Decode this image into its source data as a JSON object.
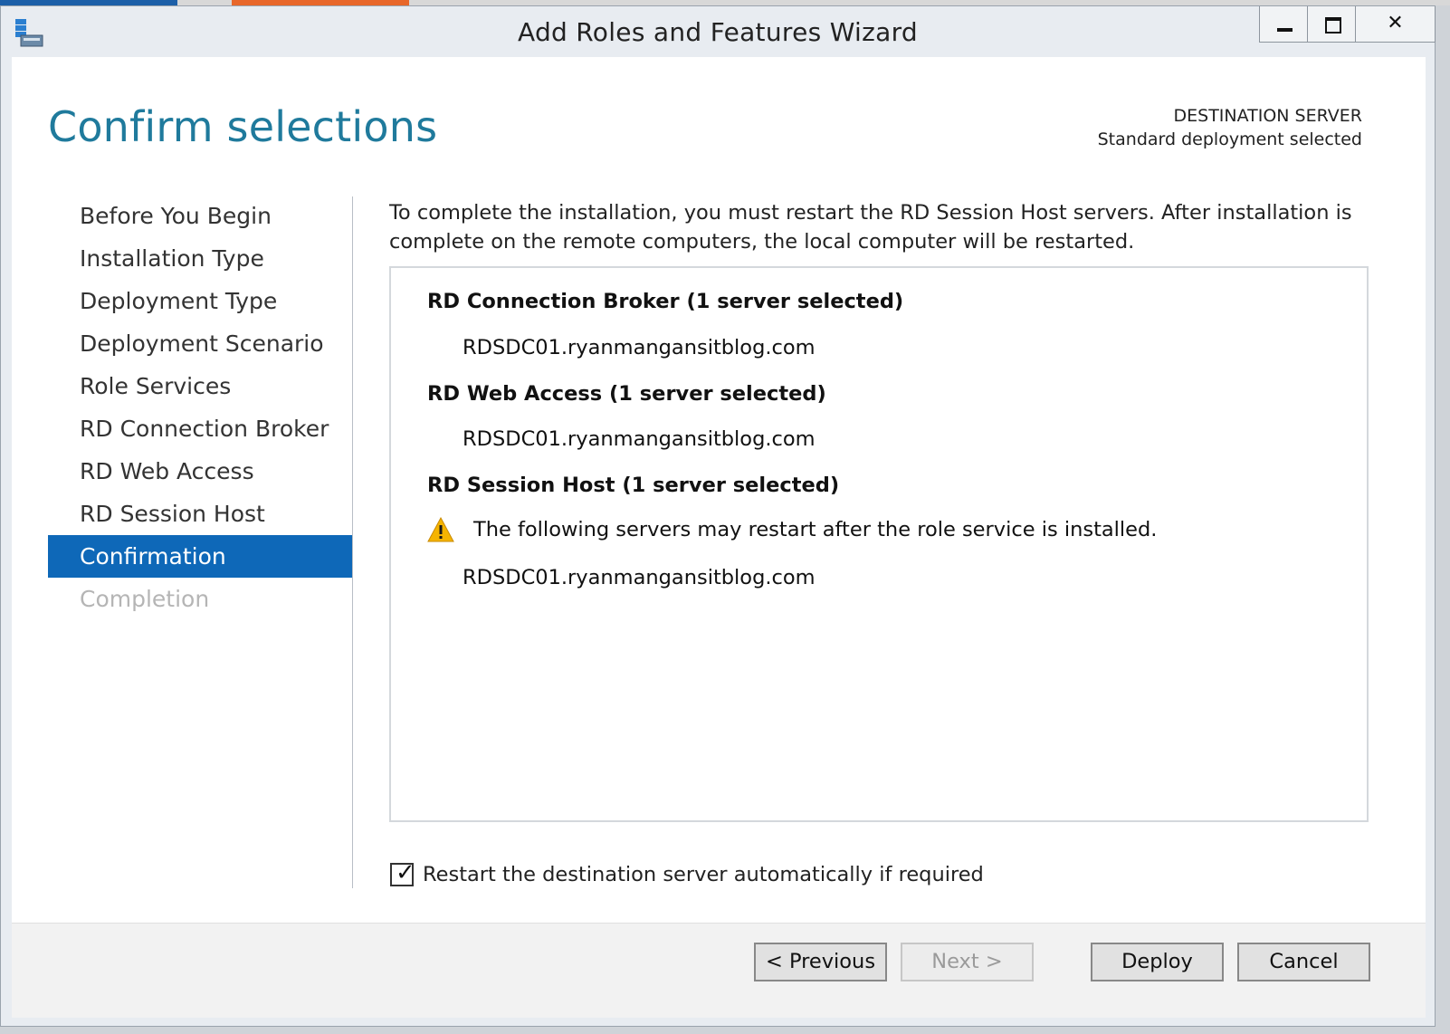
{
  "window": {
    "title": "Add Roles and Features Wizard",
    "controls": {
      "minimize_icon": "minimize-icon",
      "maximize_icon": "maximize-icon",
      "close_glyph": "✕"
    }
  },
  "header": {
    "page_title": "Confirm selections",
    "destination_label": "DESTINATION SERVER",
    "destination_value": "Standard deployment selected"
  },
  "nav": {
    "items": [
      {
        "label": "Before You Begin",
        "state": "normal"
      },
      {
        "label": "Installation Type",
        "state": "normal"
      },
      {
        "label": "Deployment Type",
        "state": "normal"
      },
      {
        "label": "Deployment Scenario",
        "state": "normal"
      },
      {
        "label": "Role Services",
        "state": "normal"
      },
      {
        "label": "RD Connection Broker",
        "state": "normal"
      },
      {
        "label": "RD Web Access",
        "state": "normal"
      },
      {
        "label": "RD Session Host",
        "state": "normal"
      },
      {
        "label": "Confirmation",
        "state": "active"
      },
      {
        "label": "Completion",
        "state": "disabled"
      }
    ]
  },
  "main": {
    "intro": "To complete the installation, you must restart the RD Session Host servers. After installation is complete on the remote computers, the local computer will be restarted.",
    "groups": [
      {
        "title": "RD Connection Broker  (1 server selected)",
        "server": "RDSDC01.ryanmangansitblog.com"
      },
      {
        "title": "RD Web Access  (1 server selected)",
        "server": "RDSDC01.ryanmangansitblog.com"
      },
      {
        "title": "RD Session Host  (1 server selected)",
        "warning": "The following servers may restart after the role service is installed.",
        "server": "RDSDC01.ryanmangansitblog.com"
      }
    ],
    "restart_checkbox": {
      "label": "Restart the destination server automatically if required",
      "checked": true
    }
  },
  "footer": {
    "previous": "< Previous",
    "next": "Next >",
    "deploy": "Deploy",
    "cancel": "Cancel"
  },
  "colors": {
    "accent": "#0e68b8",
    "title_blue": "#1f7a9c",
    "warning": "#f5b400"
  }
}
